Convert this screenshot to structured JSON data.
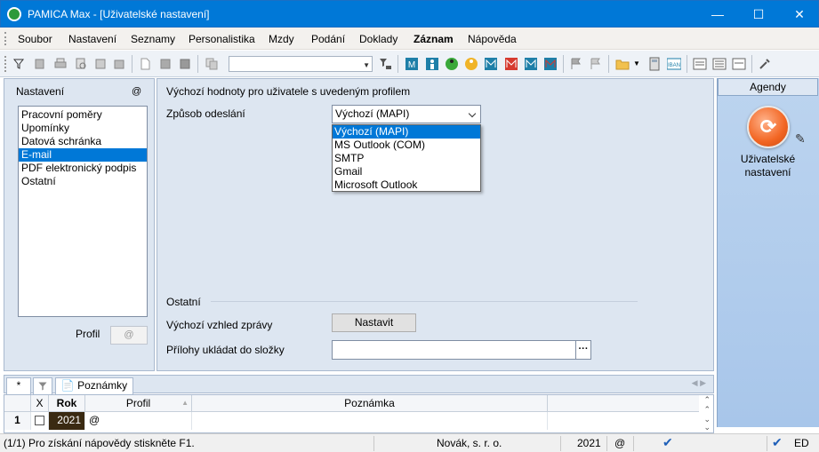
{
  "window": {
    "title": "PAMICA Max - [Uživatelské nastavení]"
  },
  "menu": [
    "Soubor",
    "Nastavení",
    "Seznamy",
    "Personalistika",
    "Mzdy",
    "Podání",
    "Doklady",
    "Záznam",
    "Nápověda"
  ],
  "toolbar": {
    "combo_value": ""
  },
  "left_panel": {
    "title": "Nastavení",
    "at": "@",
    "items": [
      "Pracovní poměry",
      "Upomínky",
      "Datová schránka",
      "E-mail",
      "PDF elektronický podpis",
      "Ostatní"
    ],
    "selected": "E-mail",
    "profil_label": "Profil",
    "profil_value": "@"
  },
  "main": {
    "heading": "Výchozí hodnoty pro uživatele s uvedeným profilem",
    "zpusob_label": "Způsob odeslání",
    "zpusob_value": "Výchozí (MAPI)",
    "options": [
      "Výchozí (MAPI)",
      "MS Outlook (COM)",
      "SMTP",
      "Gmail",
      "Microsoft Outlook"
    ],
    "ostatni_label": "Ostatní",
    "vzhled_label": "Výchozí vzhled zprávy",
    "nastavit_button": "Nastavit",
    "prilohy_label": "Přílohy ukládat do složky",
    "prilohy_value": "",
    "browse_button": "···"
  },
  "agendy": {
    "title": "Agendy",
    "label_line1": "Uživatelské",
    "label_line2": "nastavení"
  },
  "tabs": {
    "star": "*",
    "poznamky": "Poznámky"
  },
  "grid": {
    "headers": {
      "x": "X",
      "rok": "Rok",
      "profil": "Profil",
      "poznamka": "Poznámka"
    },
    "row": {
      "num": "1",
      "rok": "2021",
      "profil": "@",
      "poznamka": ""
    }
  },
  "status": {
    "help": "(1/1) Pro získání nápovědy stiskněte F1.",
    "company": "Novák, s. r. o.",
    "year": "2021",
    "at": "@",
    "ed": "ED"
  },
  "colors": {
    "titlebar": "#0078d7",
    "selection": "#0078d7",
    "panel": "#dde6f1",
    "agendy_icon": "#f26522"
  }
}
